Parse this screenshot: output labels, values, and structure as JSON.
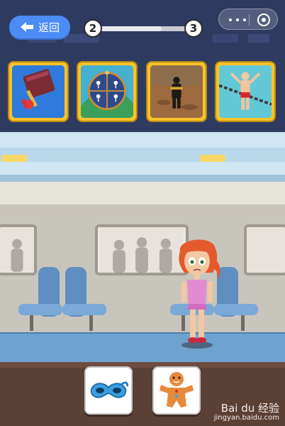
{
  "header": {
    "back_label": "返回",
    "progress": {
      "current": "2",
      "next": "3"
    }
  },
  "items": [
    {
      "name": "book-and-plunger",
      "icon": "book-plunger-icon"
    },
    {
      "name": "sleeping-pose-wheel",
      "icon": "pose-wheel-icon"
    },
    {
      "name": "desert-soldier",
      "icon": "soldier-icon"
    },
    {
      "name": "chained-man",
      "icon": "chained-man-icon"
    }
  ],
  "inventory": [
    {
      "name": "blue-mask",
      "icon": "mask-icon"
    },
    {
      "name": "gingerbread-man",
      "icon": "gingerbread-icon"
    }
  ],
  "watermark": {
    "brand": "Bai du 经验",
    "url": "jingyan.baidu.com"
  }
}
